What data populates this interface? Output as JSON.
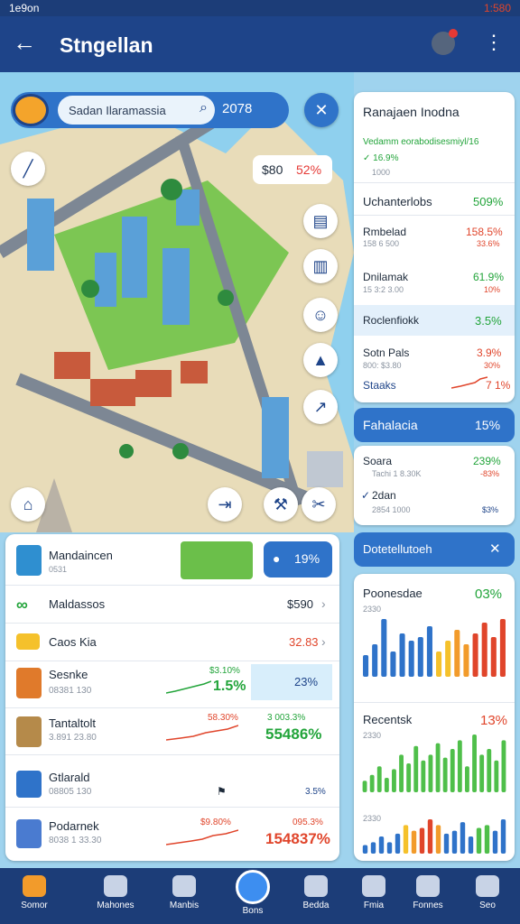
{
  "status": {
    "left": "1e9on",
    "right": "1:580"
  },
  "appbar": {
    "title": "Stngellan"
  },
  "search": {
    "placeholder": "Sadan Ilaramassia",
    "value": "2078"
  },
  "price_chip": {
    "left": "$80",
    "right": "52%"
  },
  "right_panel": {
    "title": "Ranajaen Inodna",
    "subtitle": "Vedamm eorabodisesmiyl/16",
    "sub_value": "✓ 16.9%",
    "sub_small": "1000",
    "rows": [
      {
        "label": "Uchanterlobs",
        "value": "509%"
      },
      {
        "label": "Rmbelad",
        "value": "158.5%",
        "sub": "158 6 500",
        "sub_value": "33.6%"
      },
      {
        "label": "Dnilamak",
        "value": "61.9%",
        "sub": "15 3:2 3.00",
        "sub_value": "10%"
      }
    ],
    "highlight": {
      "label": "Roclenfiokk",
      "value": "3.5%"
    },
    "rows2": [
      {
        "label": "Sotn Pals",
        "value": "3.9%",
        "sub": "800: $3.80",
        "sub_value": "30%"
      },
      {
        "label": "Staaks",
        "value": "7 1%"
      }
    ]
  },
  "section2": {
    "title": "Fahalacia",
    "value": "15%"
  },
  "section2_rows": [
    {
      "label": "Soara",
      "value": "239%",
      "sub": "Tachi 1 8.30K",
      "sub_value": "-83%"
    },
    {
      "label": "2dan",
      "value": "",
      "sub": "2854 1000",
      "sub_value": "$3%"
    }
  ],
  "section3": {
    "title": "Dotetellutoeh"
  },
  "charts": [
    {
      "label": "Poonesdae",
      "value": "03%",
      "sub": "2330"
    },
    {
      "label": "Recentsk",
      "value": "13%",
      "sub": "2330",
      "sub2": "2330"
    }
  ],
  "chart_data": [
    {
      "type": "bar",
      "values": [
        6,
        9,
        16,
        7,
        12,
        10,
        11,
        14,
        7,
        10,
        13,
        9,
        12,
        15,
        11,
        16
      ],
      "colors": [
        "#2f73c9",
        "#2f73c9",
        "#2f73c9",
        "#2f73c9",
        "#2f73c9",
        "#2f73c9",
        "#2f73c9",
        "#2f73c9",
        "#f5c12b",
        "#f5c12b",
        "#f29b2b",
        "#f29b2b",
        "#e0452b",
        "#e0452b",
        "#e0452b",
        "#e0452b"
      ]
    },
    {
      "type": "bar",
      "values": [
        4,
        6,
        9,
        5,
        8,
        13,
        10,
        16,
        11,
        13,
        17,
        12,
        15,
        18,
        9,
        20,
        13,
        15,
        11,
        18
      ],
      "colors": "#4fbf4a"
    },
    {
      "type": "bar",
      "values": [
        3,
        4,
        6,
        4,
        7,
        10,
        8,
        9,
        12,
        10,
        7,
        8,
        11,
        6,
        9,
        10,
        8,
        12
      ],
      "colors": [
        "#2f73c9",
        "#2f73c9",
        "#2f73c9",
        "#2f73c9",
        "#2f73c9",
        "#f5c12b",
        "#f29b2b",
        "#e0452b",
        "#e0452b",
        "#f29b2b",
        "#2f73c9",
        "#2f73c9",
        "#2f73c9",
        "#2f73c9",
        "#4fbf4a",
        "#4fbf4a",
        "#2f73c9",
        "#2f73c9"
      ]
    }
  ],
  "promo": {
    "value": "19%"
  },
  "list": [
    {
      "name": "Mandaincen",
      "sub": "0531",
      "price": "",
      "spark": "",
      "percent": "",
      "color": "#2f8fd0"
    },
    {
      "name": "Maldassos",
      "sub": "",
      "price": "$590",
      "spark": "",
      "percent": "",
      "color": "#22a43a"
    },
    {
      "name": "Caos Kia",
      "sub": "",
      "price": "32.83",
      "spark": "",
      "percent": "",
      "color": "#f5c12b"
    },
    {
      "name": "Sesnke",
      "sub": "08381 130",
      "price": "$3.10%",
      "spark": "1.5%",
      "percent": "23%",
      "color": "#e07a2b"
    },
    {
      "name": "Tantaltolt",
      "sub": "3.891 23.80",
      "price": "58.30%",
      "spark": "3 003.3%",
      "percent": "55486%",
      "color": "#b58a4a"
    },
    {
      "name": "Gtlarald",
      "sub": "08805 130",
      "price": "",
      "spark": "",
      "percent": "3.5%",
      "color": "#2f73c9"
    },
    {
      "name": "Podarnek",
      "sub": "8038 1 33.30",
      "price": "$9.80%",
      "spark": "095.3%",
      "percent": "154837%",
      "color": "#4a7bd0"
    }
  ],
  "nav": [
    "Somor",
    "Mahones",
    "Manbis",
    "Bons",
    "Bedda",
    "Fmia",
    "Fonnes",
    "Seo"
  ]
}
